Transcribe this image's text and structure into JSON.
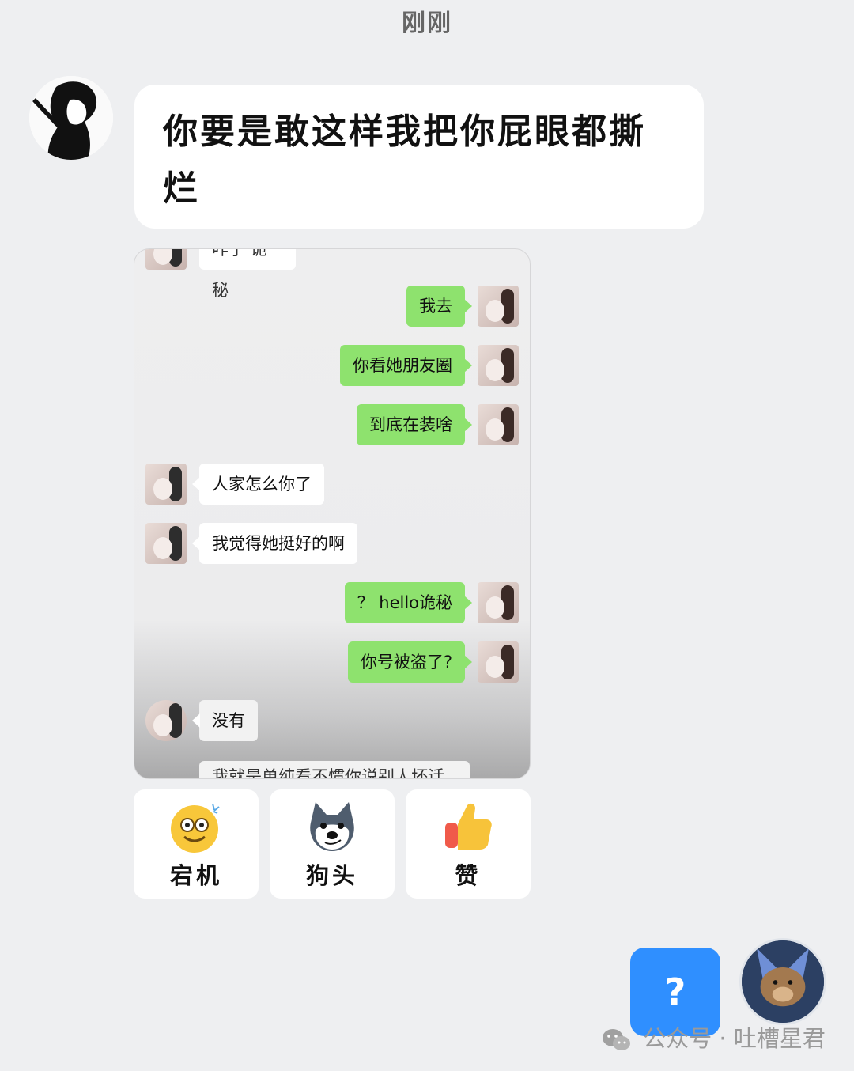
{
  "timestamp": "刚刚",
  "main_message": "你要是敢这样我把你屁眼都撕烂",
  "embedded_chat": {
    "cut_top_text": "咋了 诡秘",
    "messages": [
      {
        "side": "right",
        "text": "我去"
      },
      {
        "side": "right",
        "text": "你看她朋友圈"
      },
      {
        "side": "right",
        "text": "到底在装啥"
      },
      {
        "side": "left",
        "text": "人家怎么你了"
      },
      {
        "side": "left",
        "text": "我觉得她挺好的啊"
      },
      {
        "side": "right",
        "text": "？ hello诡秘"
      },
      {
        "side": "right",
        "text": "你号被盗了?"
      },
      {
        "side": "left",
        "text": "没有"
      }
    ],
    "cut_bottom_text": "我就是单纯看不惯你说别人坏话"
  },
  "reactions": [
    {
      "label": "宕机",
      "icon": "dizzy-face-icon"
    },
    {
      "label": "狗头",
      "icon": "doge-icon"
    },
    {
      "label": "赞",
      "icon": "thumbs-up-icon"
    }
  ],
  "help_button": "?",
  "watermark": "公众号 · 吐槽星君",
  "colors": {
    "page_bg": "#eeeff1",
    "sent_bubble": "#8ee26e",
    "help_button": "#2f8fff"
  }
}
